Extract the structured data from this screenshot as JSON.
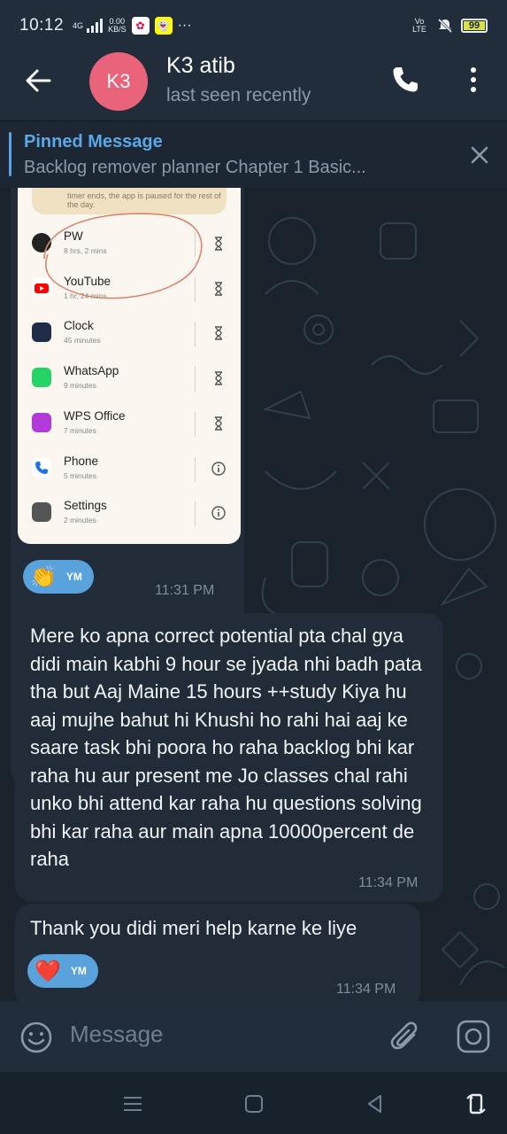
{
  "status_bar": {
    "time": "10:12",
    "network_type": "4G",
    "speed_value": "0.00",
    "speed_unit": "KB/S",
    "volte": "Vo LTE",
    "battery": "99",
    "battery_level": 0.99,
    "overflow": "···"
  },
  "header": {
    "avatar_initials": "K3",
    "avatar_color": "#e9637b",
    "contact_name": "K3 atib",
    "last_seen": "last seen recently"
  },
  "pinned": {
    "label": "Pinned Message",
    "text": "Backlog remover planner   Chapter 1   Basic..."
  },
  "screenshot_image": {
    "note_text": "timer ends, the app is paused for the rest of the day.",
    "apps": [
      {
        "name": "PW",
        "time": "8 hrs, 2 mins",
        "action": "timer-icon"
      },
      {
        "name": "YouTube",
        "time": "1 hr, 24 mins",
        "action": "timer-icon"
      },
      {
        "name": "Clock",
        "time": "45 minutes",
        "action": "timer-icon"
      },
      {
        "name": "WhatsApp",
        "time": "9 minutes",
        "action": "timer-icon"
      },
      {
        "name": "WPS Office",
        "time": "7 minutes",
        "action": "timer-icon"
      },
      {
        "name": "Phone",
        "time": "5 minutes",
        "action": "info-icon"
      },
      {
        "name": "Settings",
        "time": "2 minutes",
        "action": "info-icon"
      }
    ]
  },
  "messages": [
    {
      "type": "image",
      "reaction_emoji": "👏",
      "reaction_user": "YM",
      "time": "11:31 PM"
    },
    {
      "type": "text",
      "text": "Mere ko apna correct potential pta chal gya didi main kabhi 9 hour se jyada nhi badh pata tha but Aaj Maine 15 hours ++study Kiya hu aaj mujhe bahut hi Khushi ho rahi hai aaj ke saare task bhi poora ho raha backlog bhi kar raha hu aur present me Jo classes chal rahi unko bhi attend kar raha hu questions solving bhi kar raha  aur main apna 10000percent de raha",
      "time": "11:34 PM"
    },
    {
      "type": "text",
      "text": "Thank you didi meri help karne ke liye",
      "reaction_emoji": "❤️",
      "reaction_user": "YM",
      "time": "11:34 PM"
    }
  ],
  "input": {
    "placeholder": "Message"
  }
}
